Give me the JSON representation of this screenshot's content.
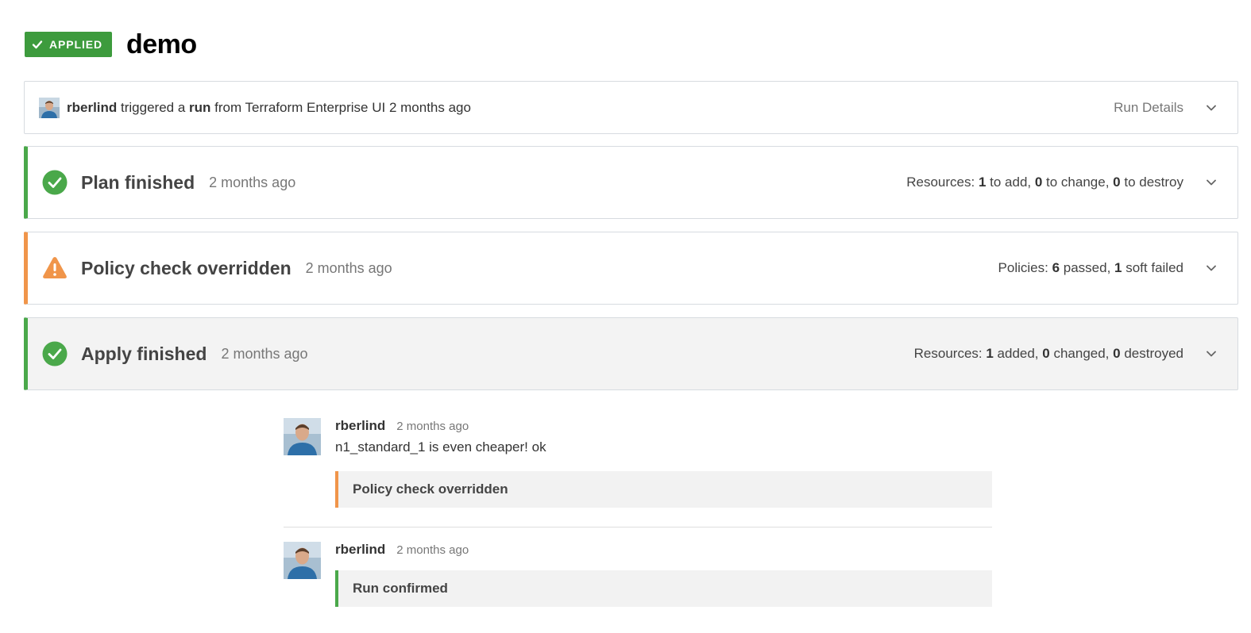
{
  "colors": {
    "success": "#4aa84a",
    "warning": "#f0954a",
    "badge": "#3d9b3d"
  },
  "header": {
    "badge_label": "APPLIED",
    "badge_icon": "check-icon",
    "title": "demo"
  },
  "run": {
    "user": "rberlind",
    "text_triggered": " triggered a ",
    "run_word": "run",
    "text_from": " from Terraform Enterprise UI 2 months ago",
    "details_label": "Run Details"
  },
  "plan": {
    "title": "Plan finished",
    "time": "2 months ago",
    "status_icon": "check-circle-icon",
    "summary": {
      "prefix": "Resources: ",
      "add": "1",
      "add_label": " to add, ",
      "change": "0",
      "change_label": " to change, ",
      "destroy": "0",
      "destroy_label": " to destroy"
    }
  },
  "policy": {
    "title": "Policy check overridden",
    "time": "2 months ago",
    "status_icon": "warning-icon",
    "summary": {
      "prefix": "Policies: ",
      "passed": "6",
      "passed_label": " passed, ",
      "soft_failed": "1",
      "soft_failed_label": " soft failed"
    }
  },
  "apply": {
    "title": "Apply finished",
    "time": "2 months ago",
    "status_icon": "check-circle-icon",
    "summary": {
      "prefix": "Resources: ",
      "added": "1",
      "added_label": " added, ",
      "changed": "0",
      "changed_label": " changed, ",
      "destroyed": "0",
      "destroyed_label": " destroyed"
    }
  },
  "comments": [
    {
      "author": "rberlind",
      "time": "2 months ago",
      "text": "n1_standard_1 is even cheaper! ok",
      "event": "Policy check overridden"
    },
    {
      "author": "rberlind",
      "time": "2 months ago",
      "event": "Run confirmed"
    }
  ]
}
